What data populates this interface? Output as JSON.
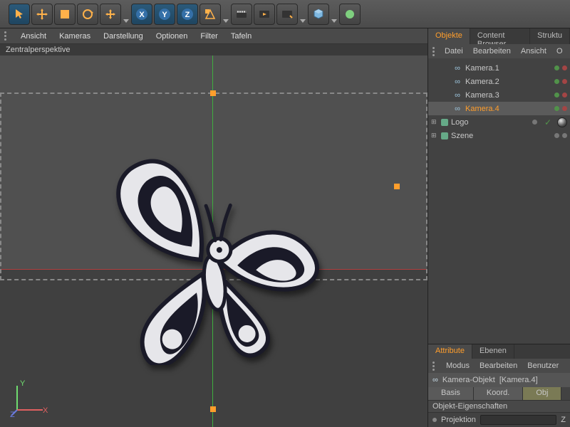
{
  "toolbar": {
    "tools": [
      "select",
      "move",
      "scale",
      "rotate",
      "axis-move",
      "axis-x",
      "axis-y",
      "axis-z",
      "cube",
      "record",
      "clapper",
      "bounce",
      "prim",
      "misc"
    ]
  },
  "viewport": {
    "menus": [
      "Ansicht",
      "Kameras",
      "Darstellung",
      "Optionen",
      "Filter",
      "Tafeln"
    ],
    "label": "Zentralperspektive",
    "world_axes": {
      "x": "X",
      "y": "Y",
      "z": "Z"
    }
  },
  "objects_panel": {
    "tabs": [
      "Objekte",
      "Content Browser",
      "Struktu"
    ],
    "active_tab": 0,
    "menus": [
      "Datei",
      "Bearbeiten",
      "Ansicht",
      "O"
    ],
    "items": [
      {
        "name": "Kamera.1",
        "type": "camera",
        "selected": false
      },
      {
        "name": "Kamera.2",
        "type": "camera",
        "selected": false
      },
      {
        "name": "Kamera.3",
        "type": "camera",
        "selected": false
      },
      {
        "name": "Kamera.4",
        "type": "camera",
        "selected": true
      },
      {
        "name": "Logo",
        "type": "group",
        "selected": false,
        "expandable": true,
        "has_tick": true,
        "has_material": true
      },
      {
        "name": "Szene",
        "type": "group",
        "selected": false,
        "expandable": true
      }
    ]
  },
  "attributes_panel": {
    "tabs": [
      "Attribute",
      "Ebenen"
    ],
    "active_tab": 0,
    "menus": [
      "Modus",
      "Bearbeiten",
      "Benutzer"
    ],
    "title_prefix": "Kamera-Objekt",
    "title_object": "[Kamera.4]",
    "subtabs": [
      "Basis",
      "Koord.",
      "Obj"
    ],
    "active_subtab": 2,
    "section_label": "Objekt-Eigenschaften",
    "rows": [
      {
        "label": "Projektion",
        "value": "Z"
      }
    ]
  }
}
